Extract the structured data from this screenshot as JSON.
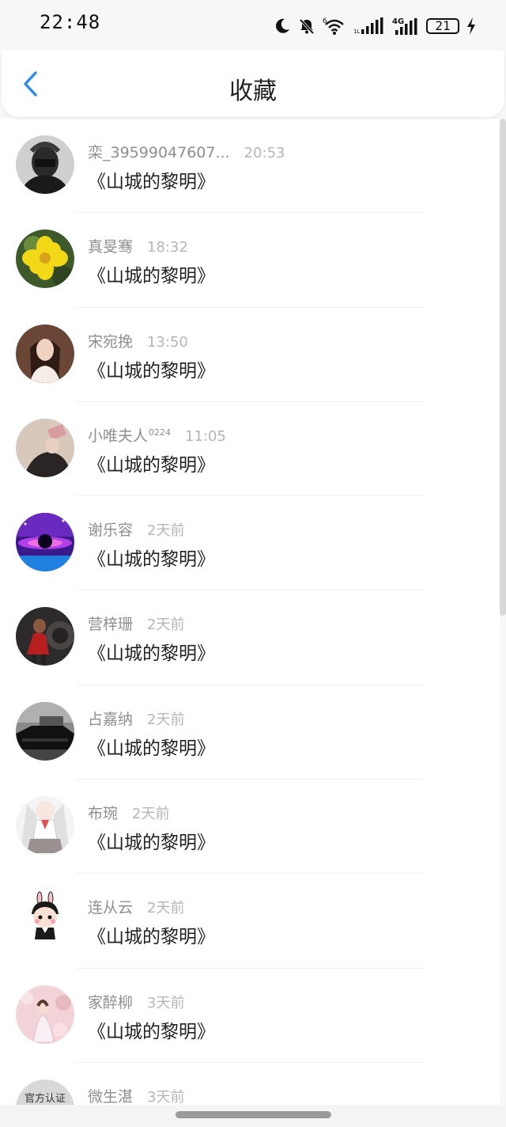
{
  "status_bar": {
    "time": "22:48",
    "battery": "21",
    "icons": [
      "moon-icon",
      "mute-bell-icon",
      "wifi-icon",
      "signal-icon",
      "signal-4g-icon",
      "battery-icon",
      "charging-icon"
    ]
  },
  "header": {
    "title": "收藏",
    "back_icon": "chevron-left-icon",
    "accent_color": "#2a8cf0"
  },
  "favorites": [
    {
      "username": "栾_39599047607...",
      "sup": "",
      "time": "20:53",
      "title": "《山城的黎明》"
    },
    {
      "username": "真旻骞",
      "sup": "",
      "time": "18:32",
      "title": "《山城的黎明》"
    },
    {
      "username": "宋宛挽",
      "sup": "",
      "time": "13:50",
      "title": "《山城的黎明》"
    },
    {
      "username": "小唯夫人",
      "sup": "0224",
      "time": "11:05",
      "title": "《山城的黎明》"
    },
    {
      "username": "谢乐容",
      "sup": "",
      "time": "2天前",
      "title": "《山城的黎明》"
    },
    {
      "username": "营梓珊",
      "sup": "",
      "time": "2天前",
      "title": "《山城的黎明》"
    },
    {
      "username": "占嘉纳",
      "sup": "",
      "time": "2天前",
      "title": "《山城的黎明》"
    },
    {
      "username": "布琬",
      "sup": "",
      "time": "2天前",
      "title": "《山城的黎明》"
    },
    {
      "username": "连从云",
      "sup": "",
      "time": "2天前",
      "title": "《山城的黎明》"
    },
    {
      "username": "家醉柳",
      "sup": "",
      "time": "3天前",
      "title": "《山城的黎明》"
    },
    {
      "username": "微生湛",
      "sup": "",
      "time": "3天前",
      "title": ""
    }
  ],
  "last_avatar_text": "官方认证"
}
